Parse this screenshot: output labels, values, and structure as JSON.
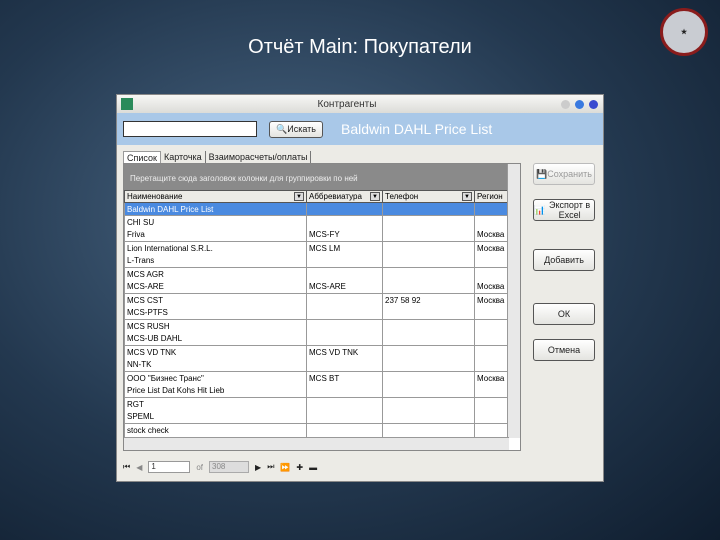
{
  "slide": {
    "title": "Отчёт Main: Покупатели",
    "logo_text": "STARDIESEL"
  },
  "window": {
    "title": "Контрагенты",
    "search_value": "",
    "search_button": "Искать",
    "heading": "Baldwin DAHL Price List"
  },
  "tabs": [
    "Список",
    "Карточка",
    "Взаиморасчеты/оплаты"
  ],
  "grid": {
    "group_hint": "Перетащите сюда заголовок колонки для группировки по ней",
    "columns": [
      "Наименование",
      "Аббревиатура",
      "Телефон",
      "Регион"
    ],
    "rows": [
      [
        "Baldwin DAHL Price List",
        "",
        "",
        ""
      ],
      [
        "CHI SU",
        "",
        "",
        ""
      ],
      [
        "Friva",
        "MCS-FY",
        "",
        "Москва"
      ],
      [
        "Lion International S.R.L.",
        "MCS LM",
        "",
        "Москва"
      ],
      [
        "L-Trans",
        "",
        "",
        ""
      ],
      [
        "MCS AGR",
        "",
        "",
        ""
      ],
      [
        "MCS-ARE",
        "MCS-ARE",
        "",
        "Москва"
      ],
      [
        "MCS CST",
        "",
        "237 58 92",
        "Москва"
      ],
      [
        "MCS-PTFS",
        "",
        "",
        ""
      ],
      [
        "MCS RUSH",
        "",
        "",
        ""
      ],
      [
        "MCS-UB DAHL",
        "",
        "",
        ""
      ],
      [
        "MCS VD TNK",
        "MCS VD TNK",
        "",
        ""
      ],
      [
        "NN-TK",
        "",
        "",
        ""
      ],
      [
        "ООО \"Бизнес Транс\"",
        "MCS BT",
        "",
        "Москва"
      ],
      [
        "Price List Dat Kohs Hit Lieb",
        "",
        "",
        ""
      ],
      [
        "RGT",
        "",
        "",
        ""
      ],
      [
        "SPEML",
        "",
        "",
        ""
      ],
      [
        "stock check",
        "",
        "",
        ""
      ]
    ]
  },
  "pager": {
    "current": "1",
    "of_label": "of",
    "total": "308"
  },
  "buttons": {
    "save": "Сохранить",
    "export": "Экспорт в Excel",
    "add": "Добавить",
    "ok": "ОК",
    "cancel": "Отмена"
  }
}
